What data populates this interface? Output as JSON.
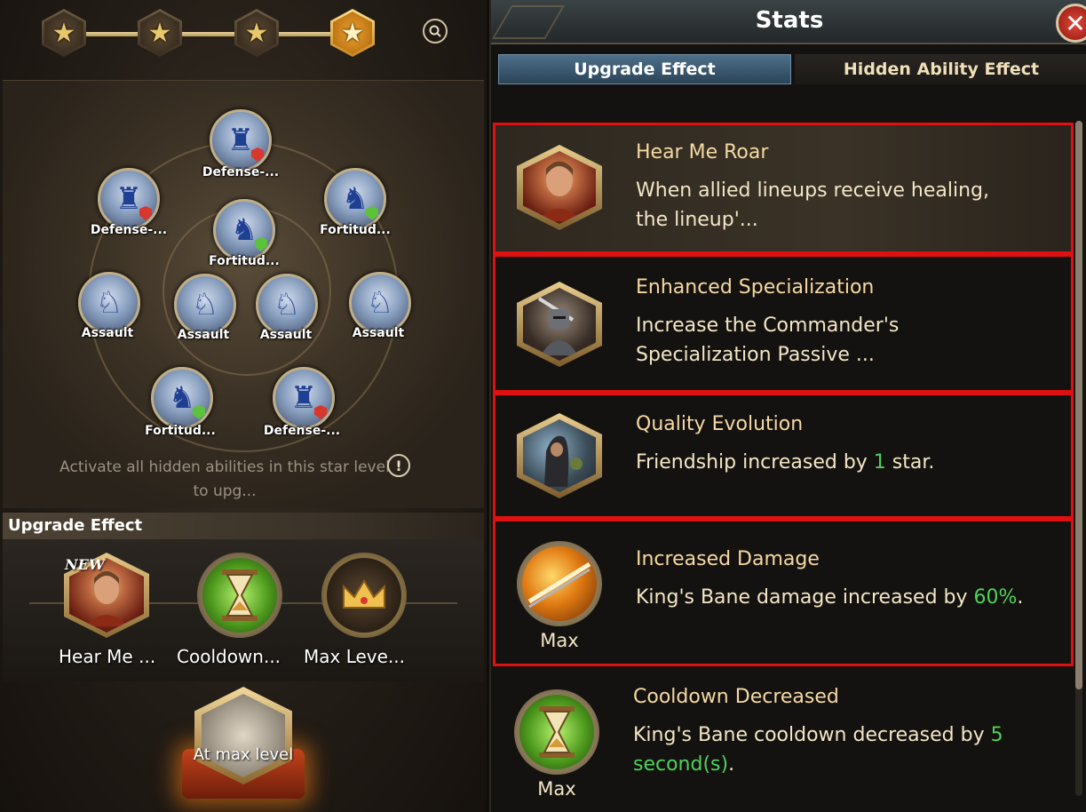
{
  "left": {
    "stars": [
      {
        "name": "star-1",
        "active": false
      },
      {
        "name": "star-2",
        "active": false
      },
      {
        "name": "star-3",
        "active": false
      },
      {
        "name": "star-4",
        "active": true
      }
    ],
    "nodes": [
      {
        "label": "Defense-...",
        "icon": "knight-shield-icon",
        "badge": "#d8372c"
      },
      {
        "label": "Defense-...",
        "icon": "knight-shield-icon",
        "badge": "#d8372c"
      },
      {
        "label": "Fortitud...",
        "icon": "knight-icon",
        "badge": "#5cc23b"
      },
      {
        "label": "Fortitud...",
        "icon": "knight-icon",
        "badge": "#5cc23b"
      },
      {
        "label": "Assault",
        "icon": "cavalry-icon",
        "badge": ""
      },
      {
        "label": "Assault",
        "icon": "cavalry-icon",
        "badge": ""
      },
      {
        "label": "Assault",
        "icon": "cavalry-icon",
        "badge": ""
      },
      {
        "label": "Assault",
        "icon": "cavalry-icon",
        "badge": ""
      },
      {
        "label": "Fortitud...",
        "icon": "knight-icon",
        "badge": "#5cc23b"
      },
      {
        "label": "Defense-...",
        "icon": "knight-shield-icon",
        "badge": "#d8372c"
      }
    ],
    "hint": "Activate all hidden abilities in this star level to upg...",
    "upgrade_header": "Upgrade Effect",
    "upgrades": [
      {
        "label": "Hear Me ...",
        "tag": "NEW",
        "icon": "commander-portrait-icon"
      },
      {
        "label": "Cooldown...",
        "icon": "hourglass-icon"
      },
      {
        "label": "Max Leve...",
        "icon": "crown-icon"
      }
    ],
    "max_level_label": "At max level"
  },
  "right": {
    "title": "Stats",
    "tabs": [
      "Upgrade Effect",
      "Hidden Ability Effect"
    ],
    "active_tab": 0,
    "effects": [
      {
        "title": "Hear Me Roar",
        "desc_parts": [
          "When allied lineups receive healing, the lineup'...",
          "",
          ""
        ],
        "max": "",
        "highlighted": true,
        "icon": "commander-portrait-icon"
      },
      {
        "title": "Enhanced Specialization",
        "desc_parts": [
          "Increase the Commander's Specialization Passive ...",
          "",
          ""
        ],
        "max": "",
        "highlighted": true,
        "icon": "knight-sword-icon"
      },
      {
        "title": "Quality Evolution",
        "desc_parts": [
          "Friendship increased by ",
          "1",
          " star."
        ],
        "max": "",
        "highlighted": true,
        "icon": "hooded-merchant-icon"
      },
      {
        "title": "Increased Damage",
        "desc_parts": [
          "King's Bane damage increased by ",
          "60%",
          "."
        ],
        "max": "Max",
        "highlighted": true,
        "icon": "blade-slash-icon"
      },
      {
        "title": "Cooldown Decreased",
        "desc_parts": [
          "King's Bane cooldown decreased by ",
          "5 second(s)",
          "."
        ],
        "max": "Max",
        "highlighted": false,
        "icon": "hourglass-icon"
      }
    ],
    "colors": {
      "highlight_border": "#e01010",
      "value_green": "#4fd25a",
      "title_gold": "#f6d9a2"
    }
  }
}
